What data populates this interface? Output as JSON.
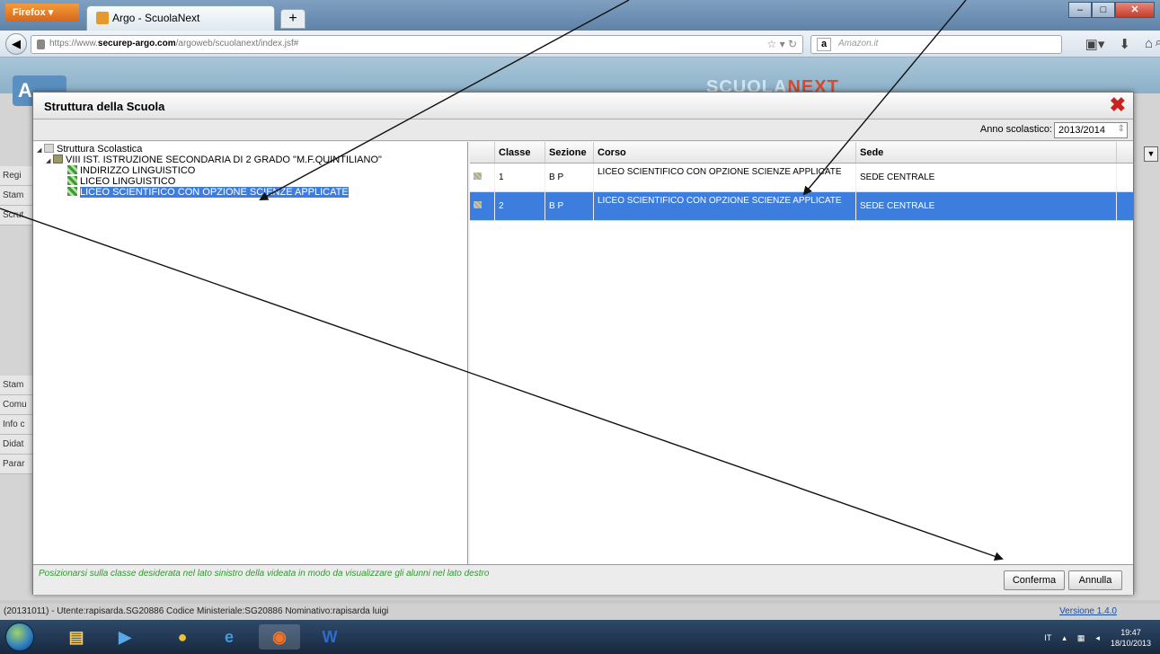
{
  "browser": {
    "menu_label": "Firefox",
    "tab_title": "Argo - ScuolaNext",
    "tab_close": "×",
    "newtab_label": "+",
    "url_prefix": "https://www.",
    "url_host": "securep-argo.com",
    "url_path": "/argoweb/scuolanext/index.jsf#",
    "search_engine": "a",
    "search_placeholder": "Amazon.it"
  },
  "app": {
    "logo": "A",
    "brand_left": "SCUOLA",
    "brand_right": "NEXT",
    "left_menu_top": [
      "Regi",
      "Stam",
      "Scrut"
    ],
    "left_menu_bottom": [
      "Stam",
      "Comu",
      "Info c",
      "Didat",
      "Parar"
    ],
    "status_text": "(20131011) - Utente:rapisarda.SG20886 Codice Ministeriale:SG20886 Nominativo:rapisarda luigi",
    "version": "Versione 1.4.0"
  },
  "dialog": {
    "title": "Struttura della Scuola",
    "anno_label": "Anno scolastico:",
    "anno_value": "2013/2014",
    "tree": {
      "root": "Struttura Scolastica",
      "school": "VIII IST. ISTRUZIONE SECONDARIA DI 2 GRADO \"M.F.QUINTILIANO\"",
      "courses": [
        "INDIRIZZO LINGUISTICO",
        "LICEO LINGUISTICO",
        "LICEO SCIENTIFICO CON OPZIONE SCIENZE APPLICATE"
      ]
    },
    "grid": {
      "headers": [
        "Classe",
        "Sezione",
        "Corso",
        "Sede"
      ],
      "rows": [
        {
          "classe": "1",
          "sezione": "B P",
          "corso": "LICEO SCIENTIFICO CON OPZIONE SCIENZE APPLICATE",
          "sede": "SEDE CENTRALE"
        },
        {
          "classe": "2",
          "sezione": "B P",
          "corso": "LICEO SCIENTIFICO CON OPZIONE SCIENZE APPLICATE",
          "sede": "SEDE CENTRALE"
        }
      ]
    },
    "hint": "Posizionarsi sulla classe desiderata nel lato sinistro della videata in modo da visualizzare gli alunni nel lato destro",
    "confirm_label": "Conferma",
    "cancel_label": "Annulla"
  },
  "taskbar": {
    "language": "IT",
    "time": "19:47",
    "date": "18/10/2013"
  },
  "colors": {
    "selection": "#3d7ddd",
    "hint": "#2c9b2c",
    "close_red": "#c8231e"
  }
}
